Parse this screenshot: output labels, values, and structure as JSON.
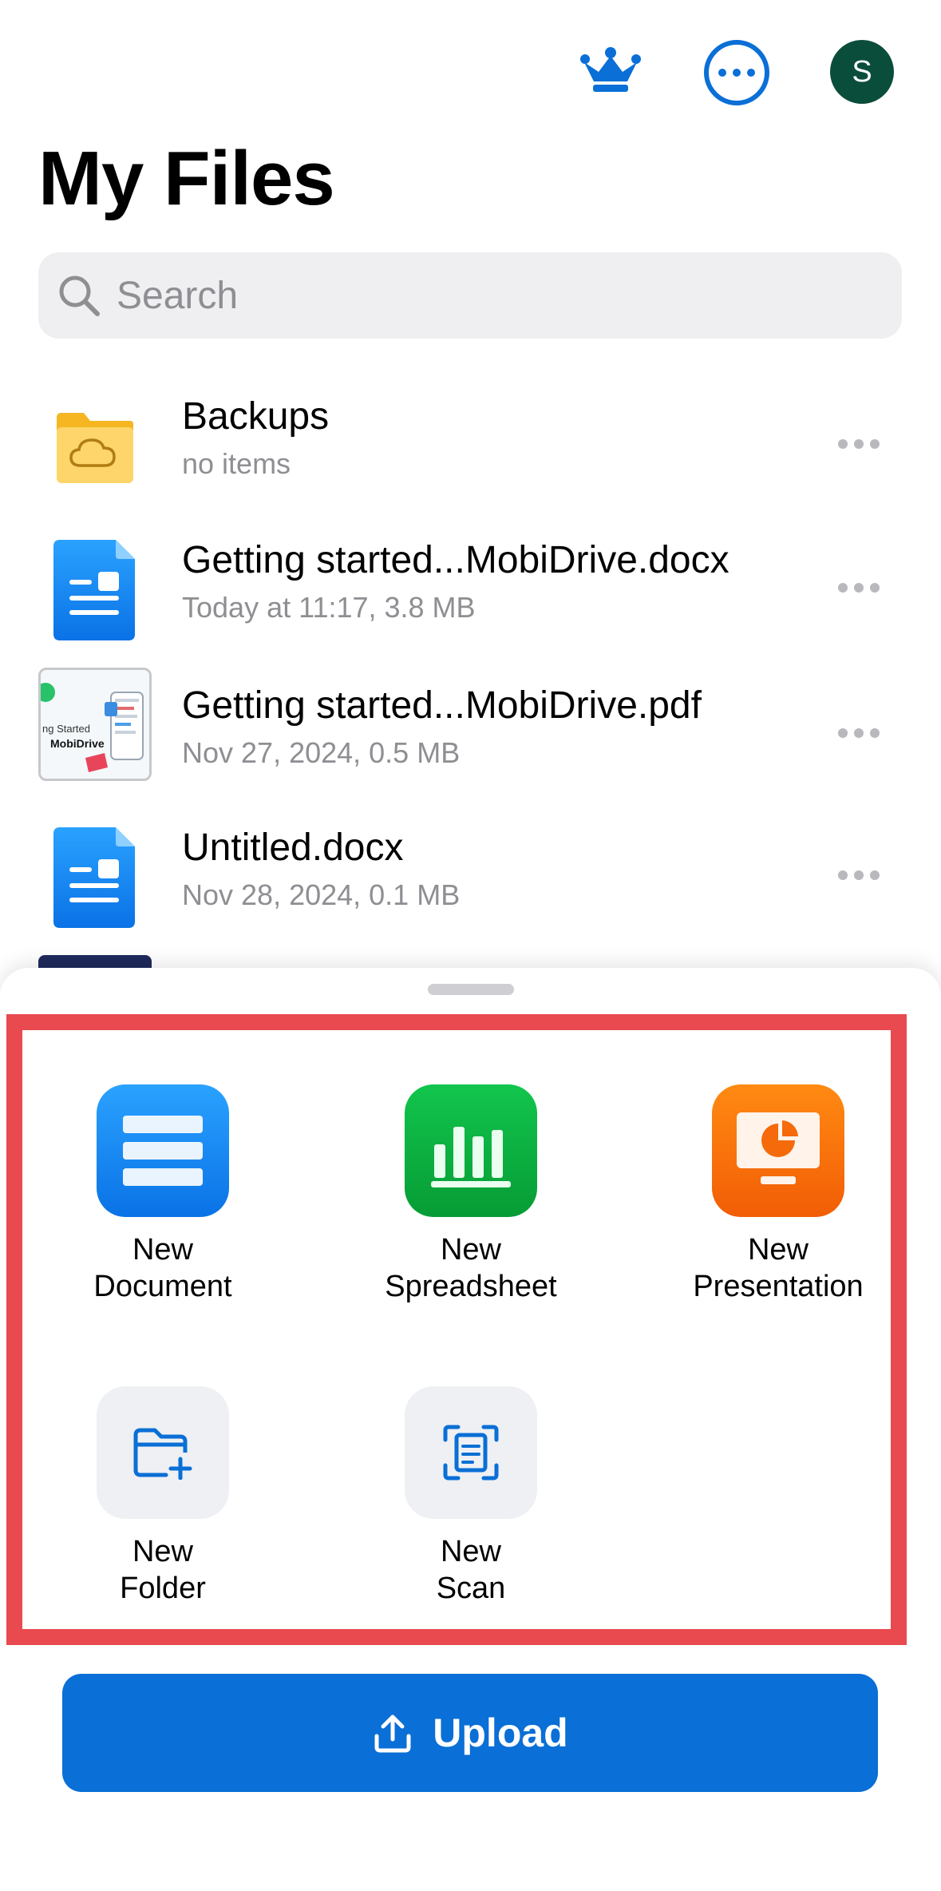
{
  "header": {
    "title": "My Files",
    "avatar_initial": "S"
  },
  "search": {
    "placeholder": "Search"
  },
  "files": [
    {
      "name": "Backups",
      "meta": "no items",
      "icon": "folder-cloud-icon"
    },
    {
      "name": "Getting started...MobiDrive.docx",
      "meta": "Today at 11:17, 3.8 MB",
      "icon": "docx-icon"
    },
    {
      "name": "Getting started...MobiDrive.pdf",
      "meta": "Nov 27, 2024, 0.5 MB",
      "icon": "pdf-thumbnail",
      "thumb_text_1": "ng Started",
      "thumb_text_2": "MobiDrive"
    },
    {
      "name": "Untitled.docx",
      "meta": "Nov 28, 2024, 0.1 MB",
      "icon": "docx-icon"
    }
  ],
  "create_sheet": {
    "actions": [
      {
        "line1": "New",
        "line2": "Document",
        "icon": "document-icon"
      },
      {
        "line1": "New",
        "line2": "Spreadsheet",
        "icon": "spreadsheet-icon"
      },
      {
        "line1": "New",
        "line2": "Presentation",
        "icon": "presentation-icon"
      },
      {
        "line1": "New",
        "line2": "Folder",
        "icon": "folder-add-icon"
      },
      {
        "line1": "New",
        "line2": "Scan",
        "icon": "scan-icon"
      }
    ],
    "upload_label": "Upload"
  },
  "colors": {
    "accent": "#0a6fd6",
    "highlight": "#e84a4f",
    "avatar": "#0b4d3b"
  }
}
